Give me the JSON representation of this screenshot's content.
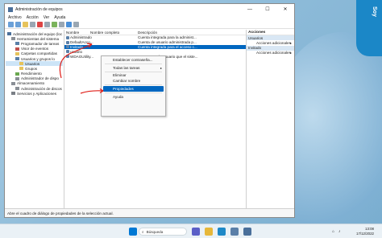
{
  "window": {
    "title": "Administración de equipos",
    "minimize": "—",
    "maximize": "☐",
    "close": "✕"
  },
  "menu": [
    "Archivo",
    "Acción",
    "Ver",
    "Ayuda"
  ],
  "tree": [
    {
      "label": "Administración del equipo (loc",
      "indent": 0,
      "icon": "computer-icon"
    },
    {
      "label": "Herramientas del sistema",
      "indent": 1,
      "icon": "tools-icon"
    },
    {
      "label": "Programador de tareas",
      "indent": 2,
      "icon": "clock-icon"
    },
    {
      "label": "Visor de eventos",
      "indent": 2,
      "icon": "event-viewer-icon"
    },
    {
      "label": "Carpetas compartidas",
      "indent": 2,
      "icon": "folder-icon"
    },
    {
      "label": "Usuarios y grupos lo",
      "indent": 2,
      "icon": "users-icon"
    },
    {
      "label": "Usuarios",
      "indent": 3,
      "icon": "folder-icon",
      "selected": true
    },
    {
      "label": "Grupos",
      "indent": 3,
      "icon": "folder-icon"
    },
    {
      "label": "Rendimiento",
      "indent": 2,
      "icon": "performance-icon"
    },
    {
      "label": "Administrador de dispo",
      "indent": 2,
      "icon": "device-manager-icon"
    },
    {
      "label": "Almacenamiento",
      "indent": 1,
      "icon": "storage-icon"
    },
    {
      "label": "Administración de discos",
      "indent": 2,
      "icon": "disk-icon"
    },
    {
      "label": "Servicios y Aplicaciones",
      "indent": 1,
      "icon": "services-icon"
    }
  ],
  "list": {
    "headers": [
      "Nombre",
      "Nombre completo",
      "Descripción"
    ],
    "rows": [
      {
        "name": "Administrado",
        "full": "",
        "desc": "Cuenta integrada para la administ..."
      },
      {
        "name": "DefaultAcco...",
        "full": "",
        "desc": "Cuenta de usuario administrada p..."
      },
      {
        "name": "Invitado",
        "full": "",
        "desc": "Cuenta integrada para el acceso c...",
        "selected": true
      },
      {
        "name": "usuario",
        "full": "",
        "desc": ""
      },
      {
        "name": "WDAGUtility...",
        "full": "",
        "desc": "Una cuenta de usuario que el siste..."
      }
    ]
  },
  "context_menu": {
    "items": [
      {
        "label": "Establecer contraseña...",
        "type": "item"
      },
      {
        "label": "",
        "type": "sep"
      },
      {
        "label": "Todas las tareas",
        "type": "arrow"
      },
      {
        "label": "",
        "type": "sep"
      },
      {
        "label": "Eliminar",
        "type": "item"
      },
      {
        "label": "Cambiar nombre",
        "type": "item"
      },
      {
        "label": "",
        "type": "sep"
      },
      {
        "label": "Propiedades",
        "type": "highlight"
      },
      {
        "label": "",
        "type": "sep"
      },
      {
        "label": "Ayuda",
        "type": "item"
      }
    ]
  },
  "actions": {
    "header": "Acciones",
    "sections": [
      {
        "title": "Usuarios",
        "items": [
          "Acciones adicionales"
        ]
      },
      {
        "title": "Invitado",
        "items": [
          "Acciones adicionales"
        ]
      }
    ]
  },
  "status": "Abre el cuadro de diálogo de propiedades de la selección actual.",
  "taskbar": {
    "search": "Búsqueda",
    "time": "13:08",
    "date": "17/12/2022"
  },
  "watermark": "Soy"
}
